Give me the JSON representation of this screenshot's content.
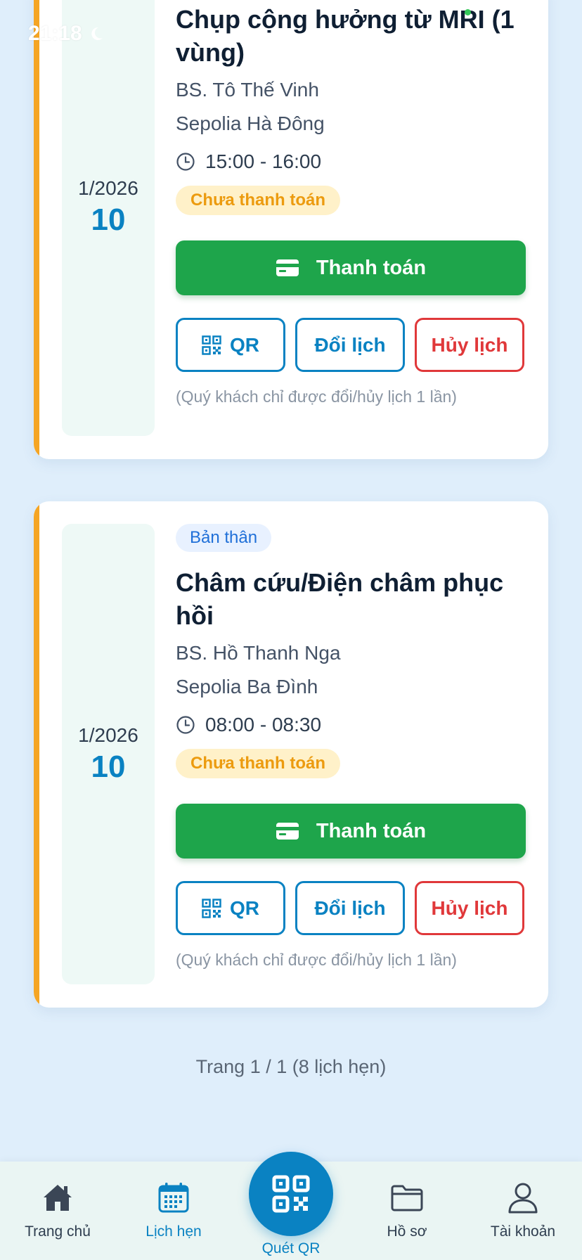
{
  "status_bar": {
    "time": "21:18"
  },
  "appointments": [
    {
      "date_month": "1/2026",
      "date_day": "10",
      "title": "Chụp cộng hưởng từ MRI (1 vùng)",
      "doctor": "BS. Tô Thế Vinh",
      "clinic": "Sepolia Hà Đông",
      "time": "15:00 - 16:00",
      "payment_status": "Chưa thanh toán",
      "pay_label": "Thanh toán",
      "qr_label": "QR",
      "reschedule_label": "Đổi lịch",
      "cancel_label": "Hủy lịch",
      "note": "(Quý khách chỉ được đổi/hủy lịch 1 lần)"
    },
    {
      "tag": "Bản thân",
      "date_month": "1/2026",
      "date_day": "10",
      "title": "Châm cứu/Điện châm phục hồi",
      "doctor": "BS. Hồ Thanh Nga",
      "clinic": "Sepolia Ba Đình",
      "time": "08:00 - 08:30",
      "payment_status": "Chưa thanh toán",
      "pay_label": "Thanh toán",
      "qr_label": "QR",
      "reschedule_label": "Đổi lịch",
      "cancel_label": "Hủy lịch",
      "note": "(Quý khách chỉ được đổi/hủy lịch 1 lần)"
    }
  ],
  "pagination": "Trang 1 / 1 (8 lịch hẹn)",
  "bottom_nav": {
    "home": "Trang chủ",
    "appointments": "Lịch hẹn",
    "scan_qr": "Quét QR",
    "records": "Hồ sơ",
    "account": "Tài khoản",
    "active": "appointments"
  },
  "colors": {
    "accent": "#0a82c2",
    "pay_green": "#1ea54b",
    "cancel_red": "#e0383a",
    "pending_orange": "#ec9b0f",
    "card_stripe": "#f5a524"
  }
}
